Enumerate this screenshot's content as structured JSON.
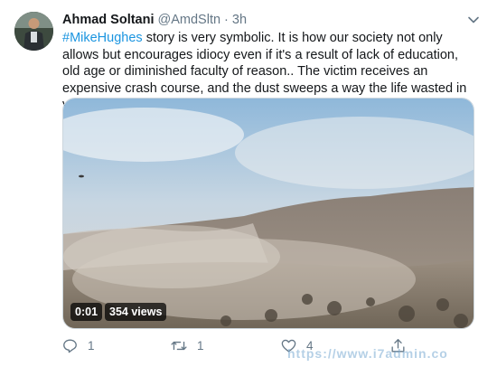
{
  "tweet": {
    "author_name": "Ahmad Soltani",
    "handle": "@AmdSltn",
    "separator": "·",
    "time": "3h",
    "hashtag": "#MikeHughes",
    "body": " story is very symbolic. It is how our society not only allows but encourages idiocy even if it's a result of lack of education, old age or diminished faculty of reason.. The victim receives an expensive crash course, and the dust sweeps a way the life wasted in vain."
  },
  "video": {
    "timestamp": "0:01",
    "views": "354 views"
  },
  "actions": {
    "reply_count": "1",
    "retweet_count": "1",
    "like_count": "4"
  },
  "watermark": "https://www.i7admin.co",
  "colors": {
    "hashtag": "#1b95e0",
    "secondary_text": "#657786"
  },
  "icons": {
    "reply": "reply-icon",
    "retweet": "retweet-icon",
    "like": "heart-icon",
    "share": "share-icon",
    "menu": "chevron-down-icon"
  }
}
